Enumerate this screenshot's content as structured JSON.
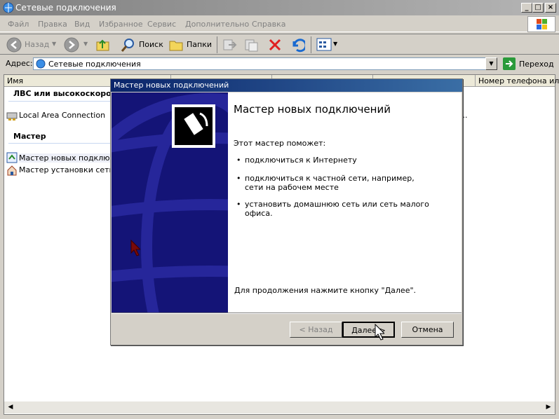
{
  "window": {
    "title": "Сетевые подключения"
  },
  "menu": [
    "Файл",
    "Правка",
    "Вид",
    "Избранное",
    "Сервис",
    "Дополнительно",
    "Справка"
  ],
  "toolbar": {
    "back": "Назад",
    "search": "Поиск",
    "folders": "Папки"
  },
  "address": {
    "label": "Адрес:",
    "value": "Сетевые подключения",
    "go": "Переход"
  },
  "list": {
    "columns": [
      "Имя",
      "Номер телефона или а"
    ],
    "groups": [
      {
        "title": "ЛВС или высокоскорост",
        "items": [
          "Local Area Connection"
        ]
      },
      {
        "title": "Мастер",
        "items": [
          "Мастер новых подключен",
          "Мастер установки сети"
        ]
      }
    ],
    "ellipsis": "..."
  },
  "wizard": {
    "title": "Мастер новых подключений",
    "heading": "Мастер новых подключений",
    "intro": "Этот мастер поможет:",
    "bullets": [
      "подключиться к Интернету",
      "подключиться к частной сети, например, сети на рабочем месте",
      "установить домашнюю сеть или сеть малого офиса."
    ],
    "footer": "Для продолжения нажмите кнопку \"Далее\".",
    "buttons": {
      "back": "< Назад",
      "next": "Далее >",
      "cancel": "Отмена"
    }
  }
}
